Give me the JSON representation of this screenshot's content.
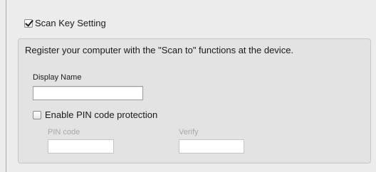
{
  "scan_key": {
    "enabled_label": "Scan Key Setting",
    "enabled": true
  },
  "group": {
    "description": "Register your computer with the \"Scan to\" functions at the device.",
    "display_name": {
      "label": "Display Name",
      "value": ""
    },
    "pin_protection": {
      "label": "Enable PIN code protection",
      "checked": false,
      "pin_label": "PIN code",
      "pin_value": "",
      "verify_label": "Verify",
      "verify_value": ""
    }
  }
}
